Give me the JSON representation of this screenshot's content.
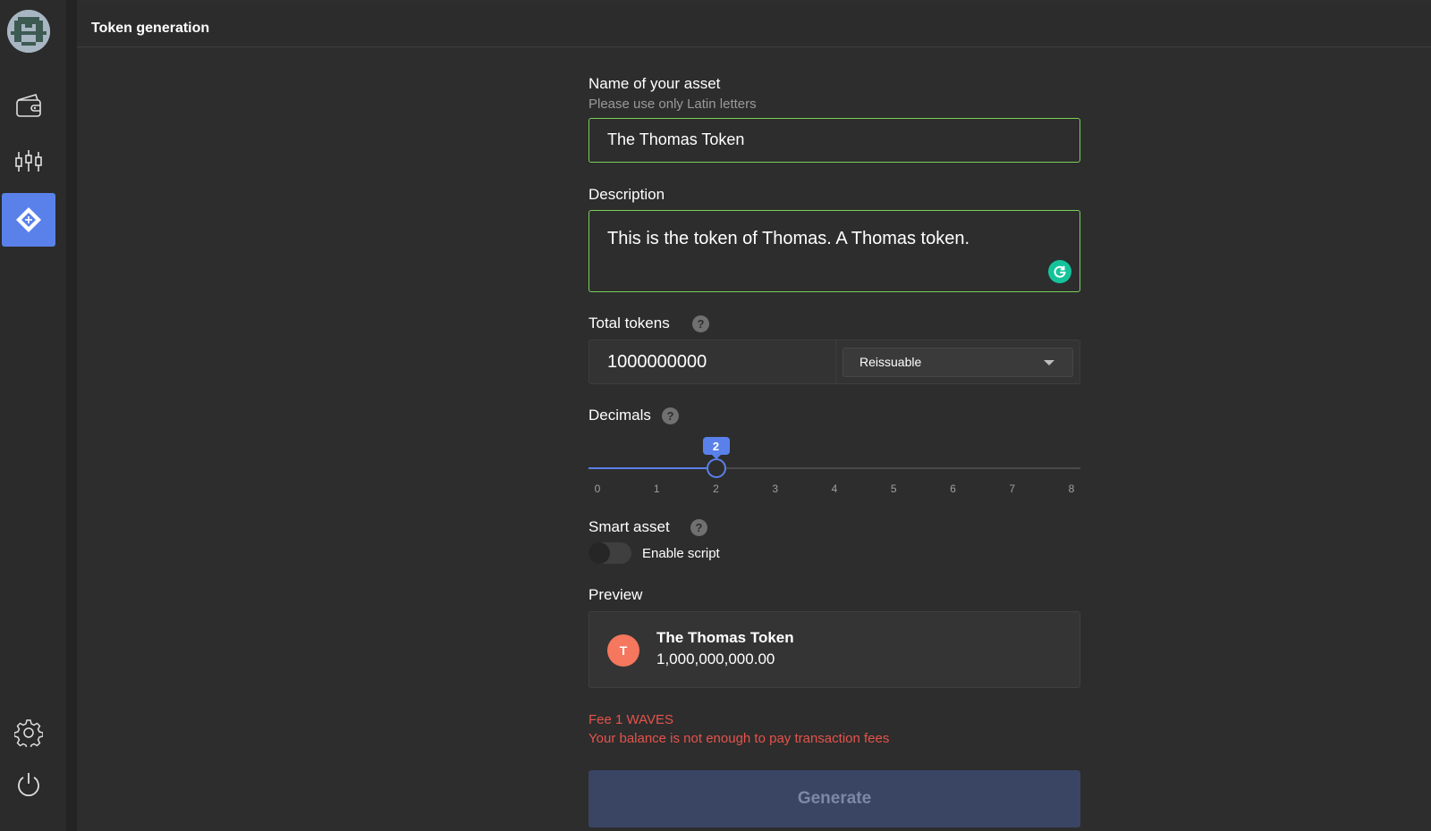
{
  "header": {
    "title": "Token generation"
  },
  "sidebar": {
    "items": [
      {
        "icon": "wallet-icon",
        "active": false
      },
      {
        "icon": "dex-chart-icon",
        "active": false
      },
      {
        "icon": "token-create-icon",
        "active": true
      },
      {
        "icon": "gear-icon",
        "active": false
      },
      {
        "icon": "power-icon",
        "active": false
      }
    ],
    "accent_color": "#5a81ea"
  },
  "form": {
    "name": {
      "label": "Name of your asset",
      "hint": "Please use only Latin letters",
      "value": "The Thomas Token"
    },
    "description": {
      "label": "Description",
      "value": "This is the token of Thomas. A Thomas token."
    },
    "total_tokens": {
      "label": "Total tokens",
      "help": "?",
      "value": "1000000000",
      "reissuable": "Reissuable"
    },
    "decimals": {
      "label": "Decimals",
      "help": "?",
      "value": "2",
      "ticks": [
        "0",
        "1",
        "2",
        "3",
        "4",
        "5",
        "6",
        "7",
        "8"
      ]
    },
    "smart_asset": {
      "label": "Smart asset",
      "help": "?",
      "toggle_label": "Enable script",
      "enabled": false
    },
    "preview": {
      "label": "Preview",
      "avatar_letter": "T",
      "avatar_color": "#f4775e",
      "name": "The Thomas Token",
      "amount": "1,000,000,000.00"
    },
    "fee": {
      "line1": "Fee 1 WAVES",
      "line2": "Your balance is not enough to pay transaction fees",
      "color": "#e5534b"
    },
    "generate_label": "Generate"
  },
  "colors": {
    "valid_border": "#7bcf5a",
    "grammarly": "#15c39a"
  }
}
